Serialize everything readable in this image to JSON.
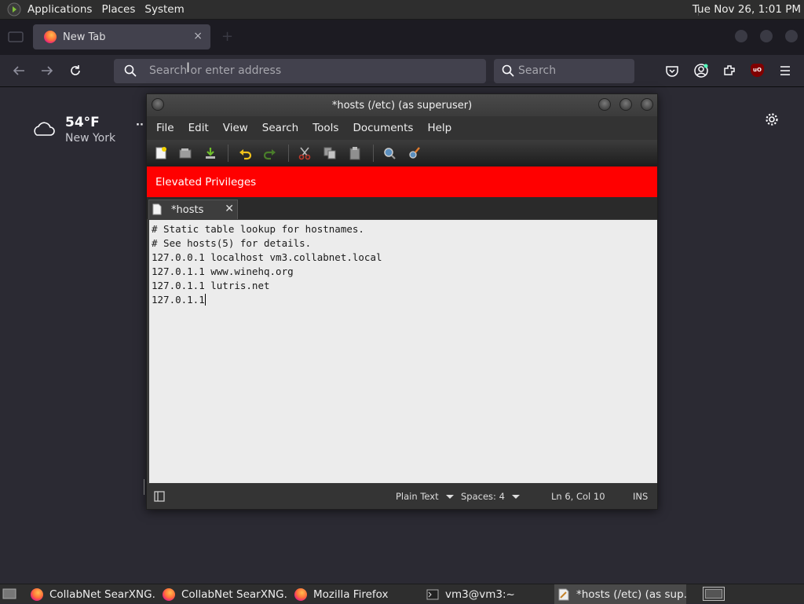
{
  "top_panel": {
    "menus": [
      "Applications",
      "Places",
      "System"
    ],
    "clock": "Tue Nov 26,  1:01 PM"
  },
  "browser": {
    "tab_title": "New Tab",
    "tab_close": "×",
    "url_placeholder": "Search or enter address",
    "search_placeholder": "Search",
    "weather": {
      "temp": "54°F",
      "city": "New York",
      "more": "··"
    },
    "accent": "#fbfbfe",
    "ublock_badge": "uO"
  },
  "gedit": {
    "title": "*hosts (/etc) (as superuser)",
    "menu": [
      "File",
      "Edit",
      "View",
      "Search",
      "Tools",
      "Documents",
      "Help"
    ],
    "toolbar_icons": [
      "new-document-icon",
      "open-icon",
      "save-icon",
      "undo-icon",
      "redo-icon",
      "cut-icon",
      "copy-icon",
      "paste-icon",
      "find-icon",
      "replace-icon"
    ],
    "elevated_label": "Elevated Privileges",
    "elevated_color": "#ff0000",
    "doc_tab": "*hosts",
    "doc_tab_close": "✕",
    "lines": [
      "# Static table lookup for hostnames.",
      "# See hosts(5) for details.",
      "127.0.0.1 localhost vm3.collabnet.local",
      "127.0.1.1 www.winehq.org",
      "127.0.1.1 lutris.net",
      "127.0.1.1"
    ],
    "status": {
      "language": "Plain Text",
      "spaces": "Spaces: 4",
      "position": "Ln 6, Col 10",
      "mode": "INS"
    }
  },
  "taskbar": {
    "items": [
      "CollabNet SearXNG…",
      "CollabNet SearXNG…",
      "Mozilla Firefox",
      "vm3@vm3:~",
      "*hosts (/etc) (as sup…"
    ]
  }
}
